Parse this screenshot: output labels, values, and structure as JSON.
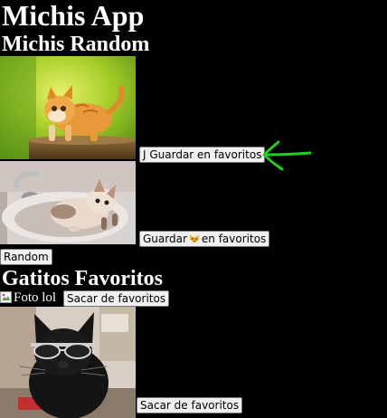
{
  "app": {
    "title": "Michis App"
  },
  "random_section": {
    "title": "Michis Random",
    "cards": [
      {
        "image": "orange-kitten-photo",
        "button_label": "J Guardar en favoritos"
      },
      {
        "image": "kitten-in-sink-photo",
        "button_prefix": "Guardar",
        "button_icon": "cat-emoji",
        "button_suffix": "en favoritos"
      }
    ],
    "random_button_label": "Random"
  },
  "favorites_section": {
    "title": "Gatitos Favoritos",
    "items": [
      {
        "image_alt": "Foto lol",
        "button_label": "Sacar de favoritos"
      },
      {
        "image": "black-cat-sunglasses-photo",
        "button_label": "Sacar de favoritos"
      }
    ]
  },
  "annotation": {
    "icon": "green-arrow-icon",
    "color": "#1fd11f"
  }
}
